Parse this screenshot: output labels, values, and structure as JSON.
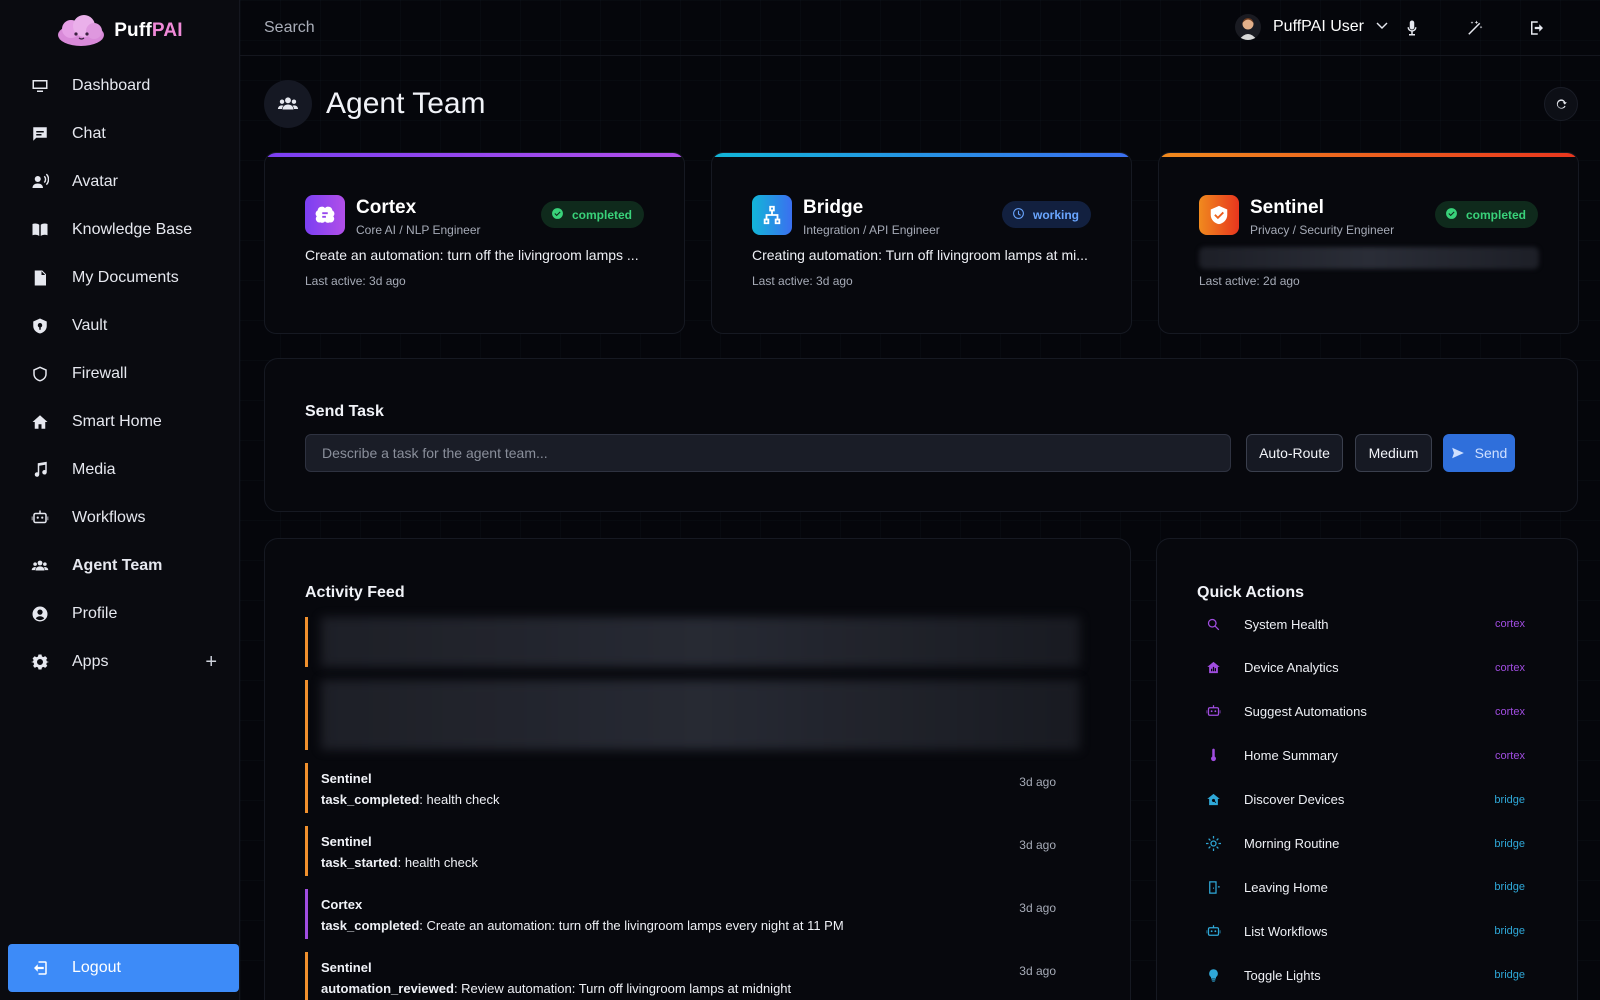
{
  "brand": {
    "name_main": "Puff",
    "name_accent": "PAI"
  },
  "sidebar": {
    "items": [
      {
        "label": "Dashboard",
        "icon": "monitor-icon"
      },
      {
        "label": "Chat",
        "icon": "chat-icon"
      },
      {
        "label": "Avatar",
        "icon": "avatar-speak-icon"
      },
      {
        "label": "Knowledge Base",
        "icon": "book-icon"
      },
      {
        "label": "My Documents",
        "icon": "document-icon"
      },
      {
        "label": "Vault",
        "icon": "vault-shield-icon"
      },
      {
        "label": "Firewall",
        "icon": "shield-icon"
      },
      {
        "label": "Smart Home",
        "icon": "home-icon"
      },
      {
        "label": "Media",
        "icon": "music-icon"
      },
      {
        "label": "Workflows",
        "icon": "robot-icon"
      },
      {
        "label": "Agent Team",
        "icon": "team-icon",
        "active": true
      },
      {
        "label": "Profile",
        "icon": "user-circle-icon"
      },
      {
        "label": "Apps",
        "icon": "gear-icon",
        "plus": "+"
      }
    ],
    "logout_label": "Logout"
  },
  "topbar": {
    "search_placeholder": "Search",
    "user_name": "PuffPAI User"
  },
  "page": {
    "title": "Agent Team"
  },
  "agents": [
    {
      "name": "Cortex",
      "role": "Core AI / NLP Engineer",
      "status": "completed",
      "task": "Create an automation: turn off the livingroom lamps ...",
      "last_active": "Last active: 3d ago",
      "accent_gradient": [
        "#7b3ff2",
        "#b14fe8"
      ]
    },
    {
      "name": "Bridge",
      "role": "Integration / API Engineer",
      "status": "working",
      "task": "Creating automation: Turn off livingroom lamps at mi...",
      "last_active": "Last active: 3d ago",
      "accent_gradient": [
        "#12b6d8",
        "#3b6ff0"
      ]
    },
    {
      "name": "Sentinel",
      "role": "Privacy / Security Engineer",
      "status": "completed",
      "task": "",
      "last_active": "Last active: 2d ago",
      "accent_gradient": [
        "#f08a1e",
        "#e8361e"
      ]
    }
  ],
  "send_task": {
    "title": "Send Task",
    "placeholder": "Describe a task for the agent team...",
    "route_label": "Auto-Route",
    "priority_label": "Medium",
    "send_label": "Send"
  },
  "activity": {
    "title": "Activity Feed",
    "items": [
      {
        "agent": "Sentinel",
        "event": "task_completed",
        "text": "health check",
        "time": "3d ago",
        "kind": "sentinel"
      },
      {
        "agent": "Sentinel",
        "event": "task_started",
        "text": "health check",
        "time": "3d ago",
        "kind": "sentinel"
      },
      {
        "agent": "Cortex",
        "event": "task_completed",
        "text": "Create an automation: turn off the livingroom lamps every night at 11 PM",
        "time": "3d ago",
        "kind": "cortex"
      },
      {
        "agent": "Sentinel",
        "event": "automation_reviewed",
        "text": "Review automation: Turn off livingroom lamps at midnight",
        "time": "3d ago",
        "kind": "sentinel"
      }
    ]
  },
  "quick_actions": {
    "title": "Quick Actions",
    "items": [
      {
        "label": "System Health",
        "tag": "cortex",
        "icon": "search-icon"
      },
      {
        "label": "Device Analytics",
        "tag": "cortex",
        "icon": "home-analytics-icon"
      },
      {
        "label": "Suggest Automations",
        "tag": "cortex",
        "icon": "robot-icon"
      },
      {
        "label": "Home Summary",
        "tag": "cortex",
        "icon": "thermometer-icon"
      },
      {
        "label": "Discover Devices",
        "tag": "bridge",
        "icon": "home-search-icon"
      },
      {
        "label": "Morning Routine",
        "tag": "bridge",
        "icon": "sun-icon"
      },
      {
        "label": "Leaving Home",
        "tag": "bridge",
        "icon": "door-exit-icon"
      },
      {
        "label": "List Workflows",
        "tag": "bridge",
        "icon": "robot-icon"
      },
      {
        "label": "Toggle Lights",
        "tag": "bridge",
        "icon": "lightbulb-icon"
      }
    ]
  },
  "colors": {
    "cortex": "#a04de0",
    "bridge": "#2fa8d8",
    "sentinel": "#f0902d",
    "logout_bg": "#3d8bf8"
  }
}
